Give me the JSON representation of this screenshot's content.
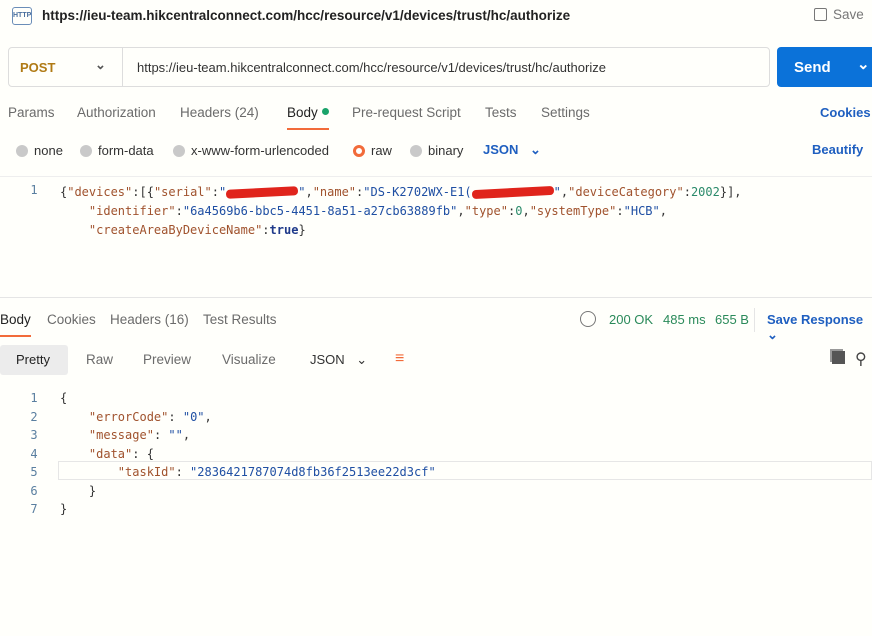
{
  "request": {
    "url_title": "https://ieu-team.hikcentralconnect.com/hcc/resource/v1/devices/trust/hc/authorize",
    "save": "Save",
    "method": "POST",
    "url": "https://ieu-team.hikcentralconnect.com/hcc/resource/v1/devices/trust/hc/authorize",
    "send": "Send"
  },
  "tabs": [
    "Params",
    "Authorization",
    "Headers (24)",
    "Body",
    "Pre-request Script",
    "Tests",
    "Settings"
  ],
  "cookies": "Cookies",
  "body_types": [
    "none",
    "form-data",
    "x-www-form-urlencoded",
    "raw",
    "binary"
  ],
  "body_format": "JSON",
  "beautify": "Beautify",
  "request_body": {
    "line": "1",
    "k1": "\"devices\"",
    "k2": "\"serial\"",
    "k3": "\"name\"",
    "v3": "\"DS-K2702WX-E1(",
    "k4": "\"deviceCategory\"",
    "v4": "2002",
    "k5": "\"identifier\"",
    "v5": "\"6a4569b6-bbc5-4451-8a51-a27cb63889fb\"",
    "k6": "\"type\"",
    "v6": "0",
    "k7": "\"systemType\"",
    "v7": "\"HCB\"",
    "k8": "\"createAreaByDeviceName\"",
    "v8": "true"
  },
  "response": {
    "tabs": [
      "Body",
      "Cookies",
      "Headers (16)",
      "Test Results"
    ],
    "status": "200 OK",
    "time": "485 ms",
    "size": "655 B",
    "save_response": "Save Response",
    "views": [
      "Pretty",
      "Raw",
      "Preview",
      "Visualize"
    ],
    "format": "JSON",
    "lines": [
      "1",
      "2",
      "3",
      "4",
      "5",
      "6",
      "7"
    ],
    "k_error": "\"errorCode\"",
    "v_error": "\"0\"",
    "k_msg": "\"message\"",
    "v_msg": "\"\"",
    "k_data": "\"data\"",
    "k_task": "\"taskId\"",
    "v_task": "\"2836421787074d8fb36f2513ee22d3cf\""
  }
}
